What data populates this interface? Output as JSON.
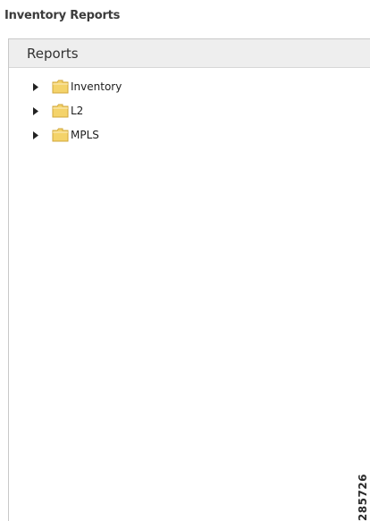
{
  "window": {
    "title": "Inventory Reports"
  },
  "panel": {
    "title": "Reports"
  },
  "tree": {
    "nodes": [
      {
        "label": "Inventory",
        "expander_icon": "triangle-right-icon",
        "folder_icon": "folder-icon",
        "expanded": false
      },
      {
        "label": "L2",
        "expander_icon": "triangle-right-icon",
        "folder_icon": "folder-icon",
        "expanded": false
      },
      {
        "label": "MPLS",
        "expander_icon": "triangle-right-icon",
        "folder_icon": "folder-icon",
        "expanded": false
      }
    ]
  },
  "figure_id": "285726",
  "colors": {
    "folder_fill": "#f4d36a",
    "folder_stroke": "#d2a73a",
    "header_bg": "#eeeeee",
    "border": "#c9c9c9"
  }
}
